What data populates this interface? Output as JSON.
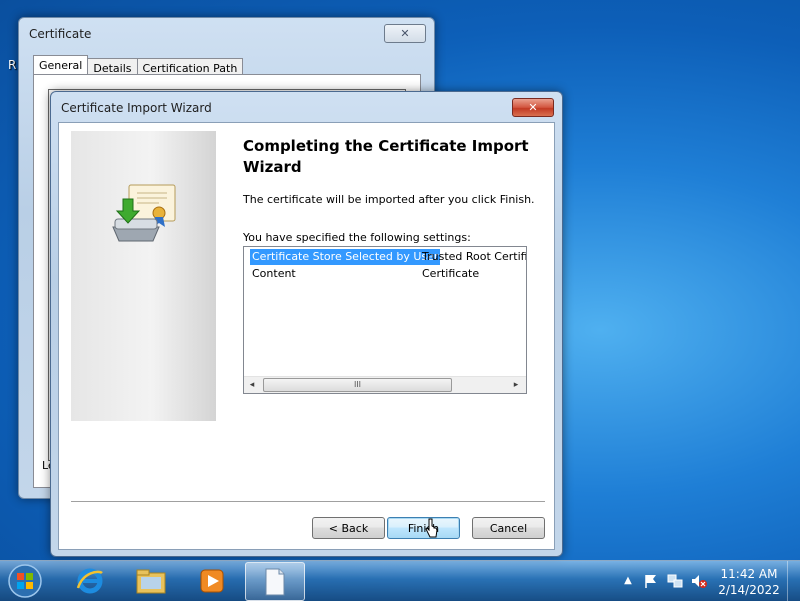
{
  "desktop": {
    "partial_label": "R"
  },
  "certificate_window": {
    "title": "Certificate",
    "close_label": "✕",
    "tabs": [
      "General",
      "Details",
      "Certification Path"
    ],
    "selected_tab": "General",
    "partial_text": "Le"
  },
  "wizard": {
    "title": "Certificate Import Wizard",
    "close_label": "✕",
    "heading": "Completing the Certificate Import Wizard",
    "description": "The certificate will be imported after you click Finish.",
    "settings_label": "You have specified the following settings:",
    "settings": [
      {
        "name": "Certificate Store Selected by User",
        "value": "Trusted Root Certifica"
      },
      {
        "name": "Content",
        "value": "Certificate"
      }
    ],
    "scroll_left": "◂",
    "scroll_right": "▸",
    "scroll_grip": "III",
    "buttons": {
      "back": "< Back",
      "finish": "Finish",
      "cancel": "Cancel"
    }
  },
  "taskbar": {
    "items": [
      "internet-explorer",
      "windows-explorer",
      "media-player",
      "notepad"
    ],
    "active_item": "notepad",
    "tray": {
      "show_hidden": "▲"
    },
    "clock": {
      "time": "11:42 AM",
      "date": "2/14/2022"
    }
  },
  "colors": {
    "selection": "#3399ff",
    "close_red": "#c23a24",
    "desktop_blue": "#1f7fd6"
  }
}
